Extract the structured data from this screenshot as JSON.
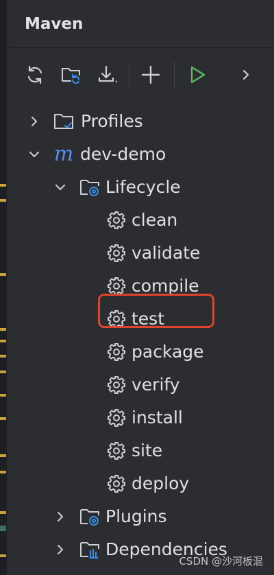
{
  "panel": {
    "title": "Maven"
  },
  "toolbar": {
    "buttons": [
      {
        "name": "reload-all-maven-projects",
        "icon": "refresh-icon"
      },
      {
        "name": "generate-sources",
        "icon": "folder-refresh-icon"
      },
      {
        "name": "download-sources",
        "icon": "download-icon"
      },
      {
        "name": "add-maven-project",
        "icon": "plus-icon"
      },
      {
        "name": "run-maven-build",
        "icon": "play-icon"
      },
      {
        "name": "more-actions",
        "icon": "chevron-right-icon"
      }
    ]
  },
  "tree": {
    "profiles": "Profiles",
    "project": {
      "logo": "m",
      "name": "dev-demo"
    },
    "lifecycle": {
      "label": "Lifecycle",
      "phases": [
        "clean",
        "validate",
        "compile",
        "test",
        "package",
        "verify",
        "install",
        "site",
        "deploy"
      ]
    },
    "plugins": "Plugins",
    "dependencies": "Dependencies"
  },
  "selected_phase": "install",
  "watermark": "CSDN @沙河板混",
  "colors": {
    "background": "#2b2d30",
    "text": "#dfe1e5",
    "maven_logo": "#5a8cf0",
    "run_green": "#5fb865",
    "highlight_red": "#e0442c",
    "badge_blue": "#3a8ee6"
  }
}
